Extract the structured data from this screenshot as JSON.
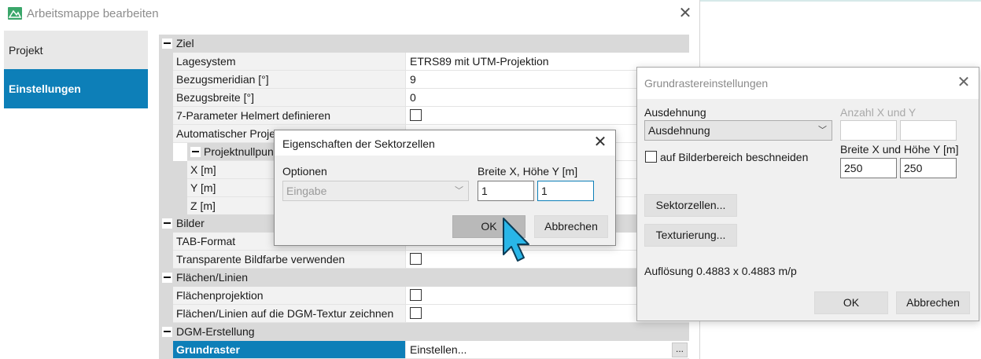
{
  "main_window": {
    "title": "Arbeitsmappe bearbeiten",
    "nav": [
      {
        "label": "Projekt",
        "selected": false
      },
      {
        "label": "Einstellungen",
        "selected": true
      }
    ]
  },
  "grid": {
    "cat_ziel": "Ziel",
    "lagesystem": {
      "label": "Lagesystem",
      "value": "ETRS89 mit UTM-Projektion"
    },
    "bezugsmeridian": {
      "label": "Bezugsmeridian [°]",
      "value": "9"
    },
    "bezugsbreite": {
      "label": "Bezugsbreite [°]",
      "value": "0"
    },
    "helmert": {
      "label": "7-Parameter Helmert definieren"
    },
    "auto_proj": {
      "label": "Automatischer Proje"
    },
    "cat_nullpunkt": "Projektnullpunkt",
    "x_m": {
      "label": "X [m]"
    },
    "y_m": {
      "label": "Y [m]"
    },
    "z_m": {
      "label": "Z [m]"
    },
    "cat_bilder": "Bilder",
    "tab_format": {
      "label": "TAB-Format"
    },
    "transparent": {
      "label": "Transparente Bildfarbe verwenden"
    },
    "cat_flaechen": "Flächen/Linien",
    "flaechenprojektion": {
      "label": "Flächenprojektion"
    },
    "flaechen_dgm": {
      "label": "Flächen/Linien auf die DGM-Textur zeichnen"
    },
    "cat_dgm": "DGM-Erstellung",
    "grundraster": {
      "label": "Grundraster",
      "value": "Einstellen...",
      "button": "..."
    }
  },
  "dialog_sektorzellen": {
    "title": "Eigenschaften der Sektorzellen",
    "options_label": "Optionen",
    "options_value": "Eingabe",
    "size_label": "Breite X, Höhe Y [m]",
    "width_value": "1",
    "height_value": "1",
    "ok": "OK",
    "cancel": "Abbrechen"
  },
  "dialog_grundraster": {
    "title": "Grundrastereinstellungen",
    "ausdehnung_label": "Ausdehnung",
    "ausdehnung_value": "Ausdehnung",
    "anzahl_label": "Anzahl X und Y",
    "anzahl_x": "",
    "anzahl_y": "",
    "crop_label": "auf Bilderbereich beschneiden",
    "size_label": "Breite X und Höhe Y [m]",
    "width_value": "250",
    "height_value": "250",
    "sektorzellen_button": "Sektorzellen...",
    "texturierung_button": "Texturierung...",
    "aufloesung": "Auflösung 0.4883 x 0.4883 m/p",
    "ok": "OK",
    "cancel": "Abbrechen"
  },
  "colors": {
    "accent": "#0d7fb8",
    "category_bg": "#d9d9d9"
  }
}
